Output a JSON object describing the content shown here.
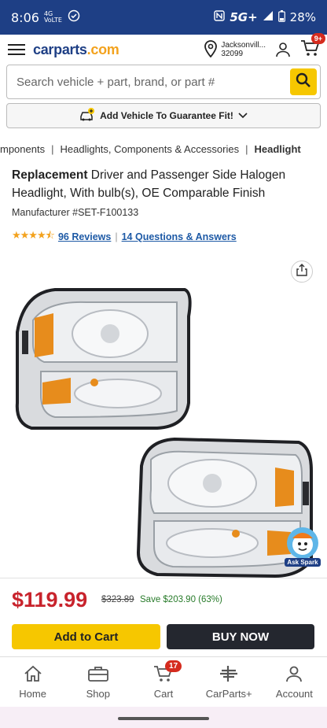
{
  "status_bar": {
    "time": "8:06",
    "net_small": "4G VoLTE",
    "network": "5G+",
    "battery": "28%"
  },
  "header": {
    "logo_main": "carparts",
    "logo_suffix": ".com",
    "location_city": "Jacksonvill...",
    "location_zip": "32099",
    "cart_count": "9+"
  },
  "search": {
    "placeholder": "Search vehicle + part, brand, or part #"
  },
  "add_vehicle": {
    "label": "Add Vehicle To Guarantee Fit!"
  },
  "breadcrumb": {
    "items": [
      "mponents",
      "Headlights, Components & Accessories",
      "Headlight"
    ],
    "separator": "|"
  },
  "product": {
    "title_bold": "Replacement",
    "title_rest": " Driver and Passenger Side Halogen Headlight, With bulb(s), OE Comparable Finish",
    "manufacturer": "Manufacturer #SET-F100133",
    "rating": 4.5,
    "stars": "★★★★⯪",
    "reviews_link": "96 Reviews",
    "qa_link": "14 Questions & Answers"
  },
  "pricing": {
    "price": "$119.99",
    "old_price": "$323.89",
    "save": "Save $203.90 (63%)"
  },
  "actions": {
    "add_to_cart": "Add to Cart",
    "buy_now": "BUY NOW"
  },
  "ask_spark": {
    "label": "Ask Spark"
  },
  "bottom_nav": {
    "items": [
      {
        "label": "Home",
        "icon": "home-icon"
      },
      {
        "label": "Shop",
        "icon": "toolbox-icon"
      },
      {
        "label": "Cart",
        "icon": "cart-icon",
        "badge": "17"
      },
      {
        "label": "CarParts+",
        "icon": "carparts-plus-icon"
      },
      {
        "label": "Account",
        "icon": "account-icon"
      }
    ]
  },
  "colors": {
    "brand_blue": "#1e3f85",
    "accent_yellow": "#f6c700",
    "price_red": "#c8232c",
    "save_green": "#287b2a"
  }
}
